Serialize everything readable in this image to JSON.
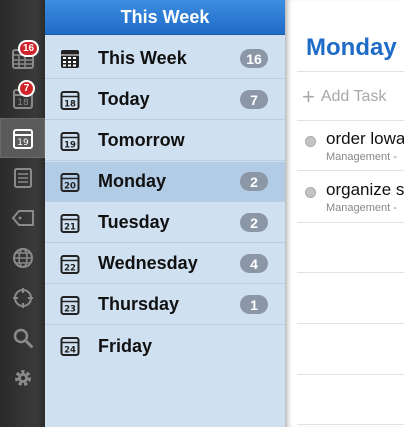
{
  "rail": {
    "badge_week": "16",
    "badge_today": "7"
  },
  "panel": {
    "title": "This Week",
    "items": [
      {
        "label": "This Week",
        "count": "16"
      },
      {
        "label": "Today",
        "count": "7",
        "day": "18"
      },
      {
        "label": "Tomorrow",
        "count": "",
        "day": "19"
      },
      {
        "label": "Monday",
        "count": "2",
        "day": "20"
      },
      {
        "label": "Tuesday",
        "count": "2",
        "day": "21"
      },
      {
        "label": "Wednesday",
        "count": "4",
        "day": "22"
      },
      {
        "label": "Thursday",
        "count": "1",
        "day": "23"
      },
      {
        "label": "Friday",
        "count": "",
        "day": "24"
      }
    ]
  },
  "detail": {
    "title": "Monday",
    "add_task_placeholder": "Add Task",
    "tasks": [
      {
        "name": "order lowa",
        "project": "Management -"
      },
      {
        "name": "organize s",
        "project": "Management -"
      }
    ]
  },
  "colors": {
    "accent": "#1f6cc8",
    "badge": "#d0242a",
    "count_pill": "#8b97a7",
    "panel_bg": "#cfe0f0"
  }
}
